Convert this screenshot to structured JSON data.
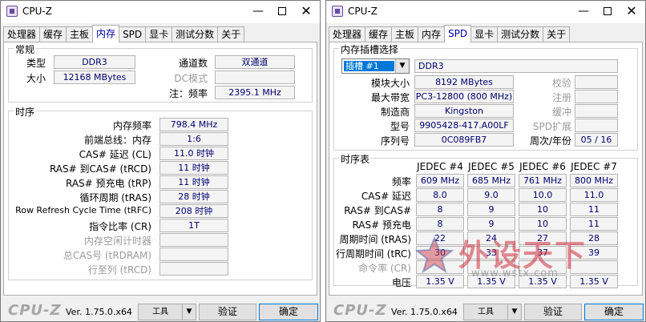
{
  "left": {
    "title": "CPU-Z",
    "tabs": [
      "处理器",
      "缓存",
      "主板",
      "内存",
      "SPD",
      "显卡",
      "测试分数",
      "关于"
    ],
    "active_tab": "内存",
    "general": {
      "title": "常规",
      "type_label": "类型",
      "type_value": "DDR3",
      "channels_label": "通道数",
      "channels_value": "双通道",
      "size_label": "大小",
      "size_value": "12168 MBytes",
      "dc_label": "DC模式",
      "dc_value": "",
      "freq_note_label": "注：频率",
      "freq_note_value": "2395.1 MHz"
    },
    "timings": {
      "title": "时序",
      "rows": [
        {
          "label": "内存频率",
          "value": "798.4 MHz",
          "disabled": false
        },
        {
          "label": "前端总线：内存",
          "value": "1:6",
          "disabled": false
        },
        {
          "label": "CAS# 延迟 (CL)",
          "value": "11.0 时钟",
          "disabled": false
        },
        {
          "label": "RAS# 到CAS# (tRCD)",
          "value": "11 时钟",
          "disabled": false
        },
        {
          "label": "RAS# 预充电 (tRP)",
          "value": "11 时钟",
          "disabled": false
        },
        {
          "label": "循环周期 (tRAS)",
          "value": "28 时钟",
          "disabled": false
        },
        {
          "label": "Row Refresh Cycle Time (tRFC)",
          "value": "208 时钟",
          "disabled": false
        },
        {
          "label": "指令比率 (CR)",
          "value": "1T",
          "disabled": false
        },
        {
          "label": "内存空闲计时器",
          "value": "",
          "disabled": true
        },
        {
          "label": "总CAS号 (tRDRAM)",
          "value": "",
          "disabled": true
        },
        {
          "label": "行至列 (tRCD)",
          "value": "",
          "disabled": true
        }
      ]
    },
    "footer": {
      "logo": "CPU-Z",
      "version": "Ver. 1.75.0.x64",
      "tools": "工具",
      "validate": "验证",
      "ok": "确定"
    }
  },
  "right": {
    "title": "CPU-Z",
    "tabs": [
      "处理器",
      "缓存",
      "主板",
      "内存",
      "SPD",
      "显卡",
      "测试分数",
      "关于"
    ],
    "active_tab": "SPD",
    "slot": {
      "title": "内存插槽选择",
      "selected": "插槽 #1",
      "type_value": "DDR3",
      "module_size_label": "模块大小",
      "module_size_value": "8192 MBytes",
      "check_label": "校验",
      "max_bw_label": "最大带宽",
      "max_bw_value": "PC3-12800 (800 MHz)",
      "registered_label": "注册",
      "manufacturer_label": "制造商",
      "manufacturer_value": "Kingston",
      "buffered_label": "缓冲",
      "part_label": "型号",
      "part_value": "9905428-417.A00LF",
      "spd_ext_label": "SPD扩展",
      "serial_label": "序列号",
      "serial_value": "0C089FB7",
      "week_year_label": "周次/年份",
      "week_year_value": "05 / 16"
    },
    "timing_table": {
      "title": "时序表",
      "headers": [
        "JEDEC #4",
        "JEDEC #5",
        "JEDEC #6",
        "JEDEC #7"
      ],
      "rows": [
        {
          "label": "频率",
          "values": [
            "609 MHz",
            "685 MHz",
            "761 MHz",
            "800 MHz"
          ],
          "disabled": false
        },
        {
          "label": "CAS# 延迟",
          "values": [
            "8.0",
            "9.0",
            "10.0",
            "11.0"
          ],
          "disabled": false
        },
        {
          "label": "RAS# 到CAS#",
          "values": [
            "8",
            "9",
            "10",
            "11"
          ],
          "disabled": false
        },
        {
          "label": "RAS# 预充电",
          "values": [
            "8",
            "9",
            "10",
            "11"
          ],
          "disabled": false
        },
        {
          "label": "周期时间 (tRAS)",
          "values": [
            "22",
            "24",
            "27",
            "28"
          ],
          "disabled": false
        },
        {
          "label": "行周期时间 (tRC)",
          "values": [
            "30",
            "33",
            "37",
            "39"
          ],
          "disabled": false
        },
        {
          "label": "命令率 (CR)",
          "values": [
            "",
            "",
            "",
            ""
          ],
          "disabled": true
        },
        {
          "label": "电压",
          "values": [
            "1.35 V",
            "1.35 V",
            "1.35 V",
            "1.35 V"
          ],
          "disabled": false
        }
      ]
    },
    "footer": {
      "logo": "CPU-Z",
      "version": "Ver. 1.75.0.x64",
      "tools": "工具",
      "validate": "验证",
      "ok": "确定"
    }
  },
  "watermark": {
    "text": "外设天下",
    "url": "www.wstx.com"
  },
  "colors": {
    "value_text": "#00006e",
    "active_tab_text": "#0000aa",
    "selection": "#0078d7",
    "logo": "#a5a5a5"
  }
}
